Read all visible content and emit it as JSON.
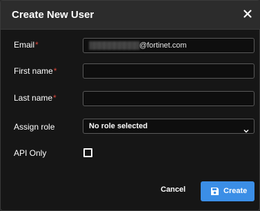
{
  "dialog": {
    "title": "Create New User",
    "close_icon": "close-icon"
  },
  "form": {
    "email": {
      "label": "Email",
      "required_marker": "*",
      "value_obscured": "▒▒▒▒▒▒▒▒▒▒",
      "value_domain": "@fortinet.com"
    },
    "first_name": {
      "label": "First name",
      "required_marker": "*",
      "value": ""
    },
    "last_name": {
      "label": "Last name",
      "required_marker": "*",
      "value": ""
    },
    "assign_role": {
      "label": "Assign role",
      "selected": "No role selected",
      "icon": "chevron-down-icon"
    },
    "api_only": {
      "label": "API Only",
      "checked": false
    }
  },
  "actions": {
    "cancel_label": "Cancel",
    "create_label": "Create",
    "create_icon": "save-icon"
  },
  "colors": {
    "dialog_bg": "#161616",
    "header_bg": "#2c2c2c",
    "required": "#d9473b",
    "primary": "#3b8ee6"
  }
}
